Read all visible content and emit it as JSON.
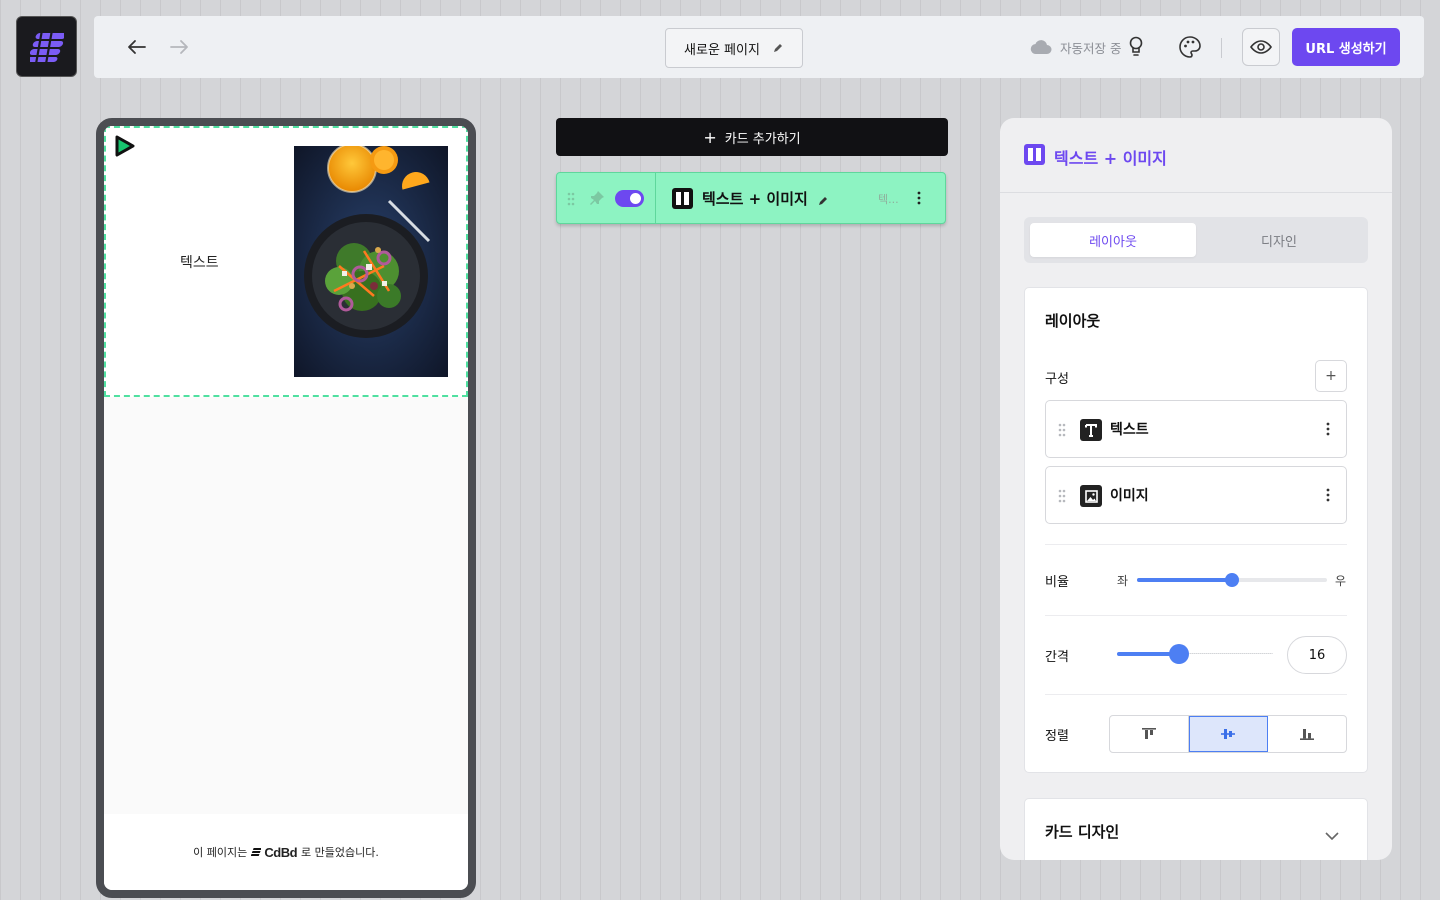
{
  "topbar": {
    "page_name": "새로운 페이지",
    "autosave_text": "자동저장 중",
    "url_button": "URL 생성하기"
  },
  "phone": {
    "card_text": "텍스트",
    "footer_prefix": "이 페이지는",
    "footer_brand": "CdBd",
    "footer_suffix": "로 만들었습니다."
  },
  "middle": {
    "add_card_label": "카드 추가하기",
    "card_row": {
      "title": "텍스트 + 이미지",
      "subtitle": "텍...",
      "visible": true
    }
  },
  "panel": {
    "title": "텍스트 + 이미지",
    "tabs": [
      {
        "label": "레이아웃",
        "active": true
      },
      {
        "label": "디자인",
        "active": false
      }
    ],
    "layout": {
      "title": "레이아웃",
      "composition_label": "구성",
      "components": [
        {
          "label": "텍스트",
          "icon": "text-icon"
        },
        {
          "label": "이미지",
          "icon": "image-icon"
        }
      ],
      "ratio_label": "비율",
      "ratio_left": "좌",
      "ratio_right": "우",
      "ratio_value_fraction": 0.5,
      "spacing_label": "간격",
      "spacing_value": "16",
      "align_label": "정렬",
      "align_options": [
        "top",
        "center",
        "bottom"
      ],
      "align_selected": "center"
    },
    "card_design_title": "카드 디자인"
  },
  "colors": {
    "accent": "#6d48f0",
    "card_green": "#8df3c2",
    "slider_blue": "#4d7ff3"
  }
}
